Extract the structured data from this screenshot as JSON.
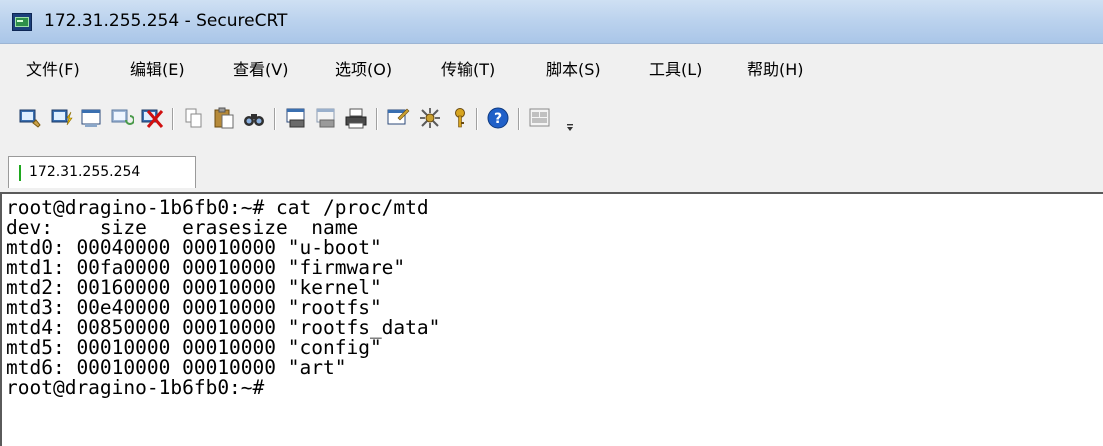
{
  "window": {
    "title": "172.31.255.254 - SecureCRT"
  },
  "menu": [
    "文件(F)",
    "编辑(E)",
    "查看(V)",
    "选项(O)",
    "传输(T)",
    "脚本(S)",
    "工具(L)",
    "帮助(H)"
  ],
  "toolbar": {
    "icons": [
      "connect-icon",
      "quick-connect-icon",
      "connect-tab-icon",
      "reconnect-icon",
      "disconnect-icon",
      "copy-icon",
      "paste-icon",
      "find-icon",
      "print-setup-icon",
      "print-selection-icon",
      "print-icon",
      "session-options-icon",
      "global-options-icon",
      "key-icon",
      "help-icon",
      "keymap-icon"
    ]
  },
  "tab": {
    "label": "172.31.255.254"
  },
  "terminal": {
    "lines": [
      "root@dragino-1b6fb0:~# cat /proc/mtd",
      "dev:    size   erasesize  name",
      "mtd0: 00040000 00010000 \"u-boot\"",
      "mtd1: 00fa0000 00010000 \"firmware\"",
      "mtd2: 00160000 00010000 \"kernel\"",
      "mtd3: 00e40000 00010000 \"rootfs\"",
      "mtd4: 00850000 00010000 \"rootfs_data\"",
      "mtd5: 00010000 00010000 \"config\"",
      "mtd6: 00010000 00010000 \"art\"",
      "root@dragino-1b6fb0:~#"
    ]
  }
}
